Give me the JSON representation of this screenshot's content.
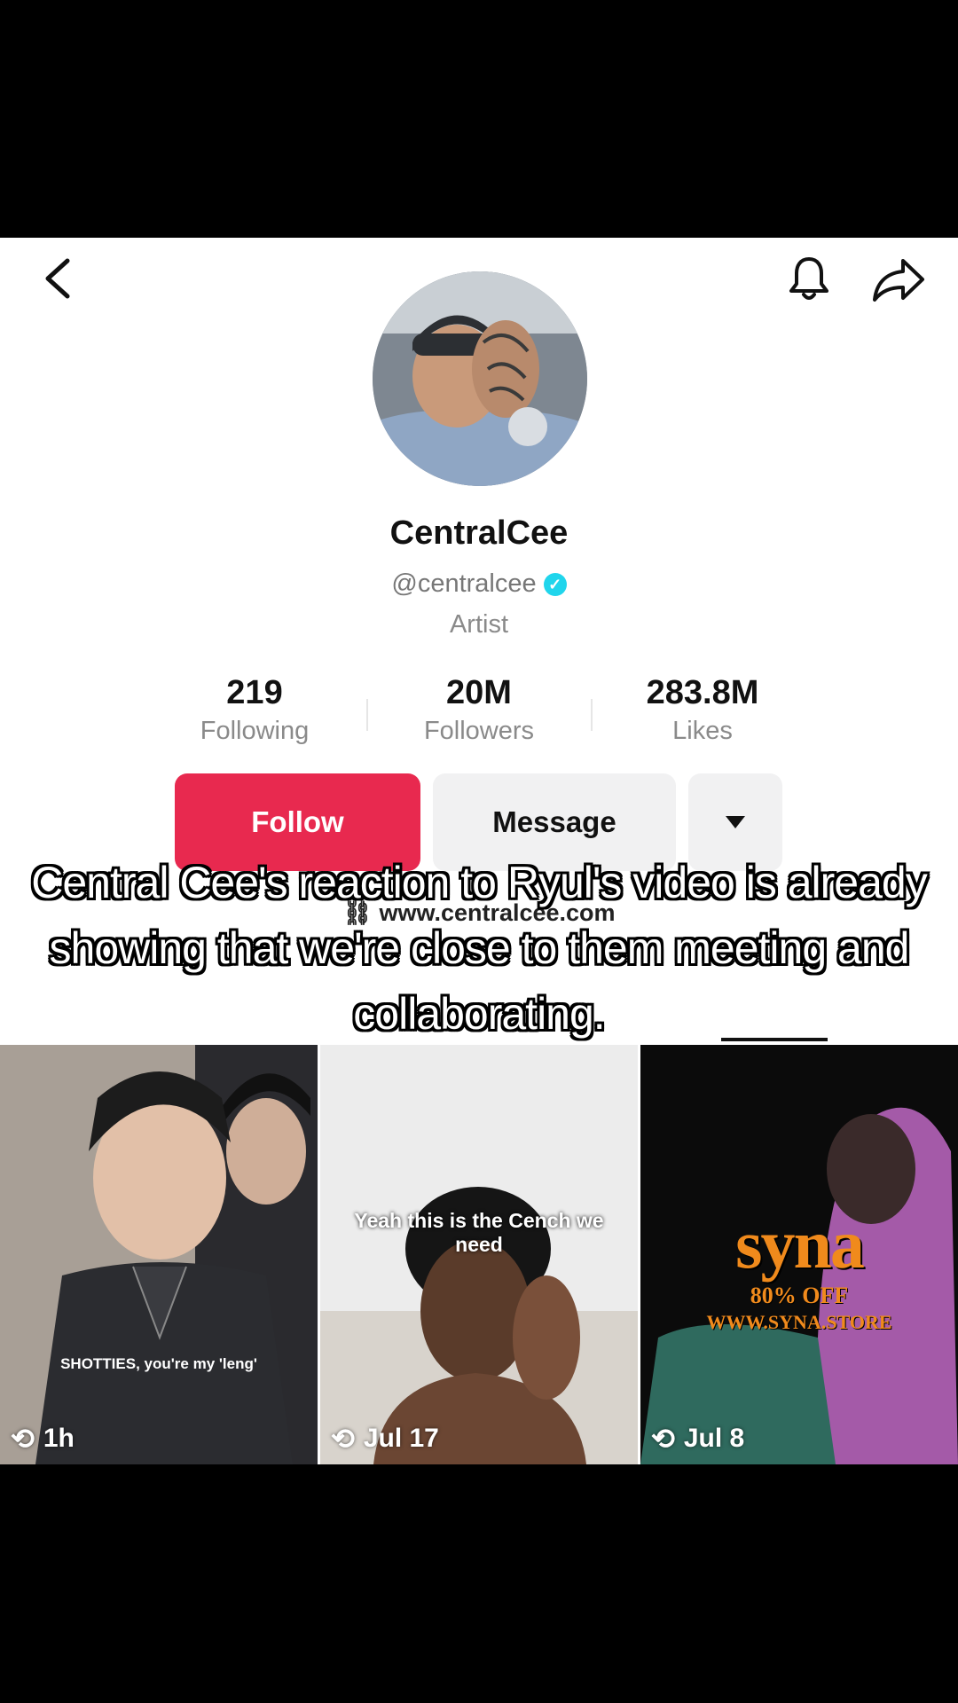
{
  "profile": {
    "display_name": "CentralCee",
    "handle": "@centralcee",
    "verified_icon": "verified-check-icon",
    "category": "Artist",
    "website": "www.centralcee.com"
  },
  "stats": [
    {
      "value": "219",
      "label": "Following"
    },
    {
      "value": "20M",
      "label": "Followers"
    },
    {
      "value": "283.8M",
      "label": "Likes"
    }
  ],
  "actions": {
    "follow_label": "Follow",
    "message_label": "Message"
  },
  "caption": "Central Cee's reaction to Ryul's video is already showing that we're close to them meeting and collaborating.",
  "videos": [
    {
      "overlay_text": "SHOTTIES, you're my 'leng'",
      "time": "1h"
    },
    {
      "overlay_text": "Yeah this is the Cench we need",
      "time": "Jul 17"
    },
    {
      "overlay_brand": "syna",
      "overlay_line1": "80% OFF",
      "overlay_line2": "WWW.SYNA.STORE",
      "time": "Jul 8"
    }
  ],
  "colors": {
    "follow": "#e8294f",
    "verified": "#20d5ec",
    "syna_orange": "#f08a1c"
  }
}
